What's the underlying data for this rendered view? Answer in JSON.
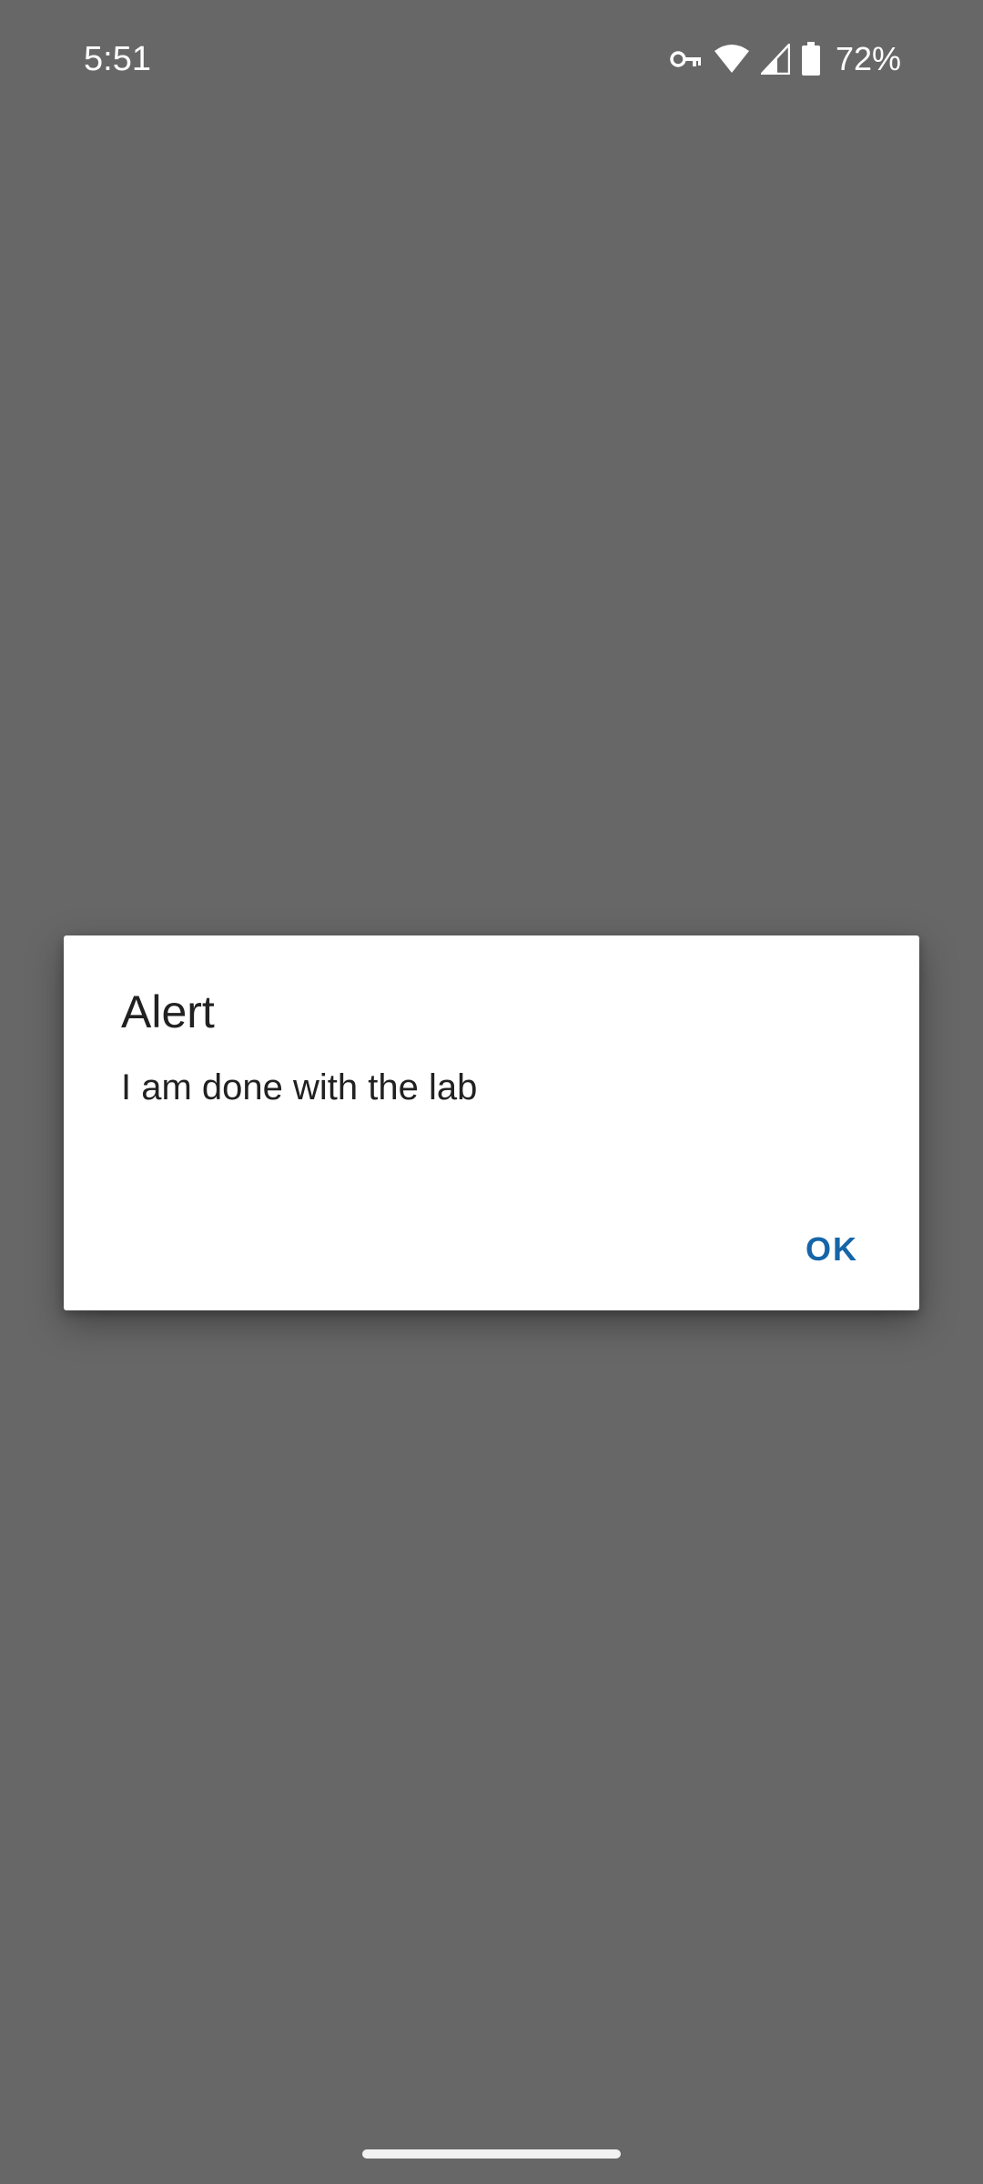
{
  "status_bar": {
    "time": "5:51",
    "battery_percent": "72%",
    "icons": [
      "vpn-key-icon",
      "wifi-icon",
      "cell-signal-icon",
      "battery-icon"
    ]
  },
  "dialog": {
    "title": "Alert",
    "message": "I am done with the lab",
    "ok_label": "OK",
    "accent_color": "#1565a8"
  },
  "colors": {
    "scrim": "#676767",
    "dialog_bg": "#ffffff",
    "text": "#212121"
  }
}
